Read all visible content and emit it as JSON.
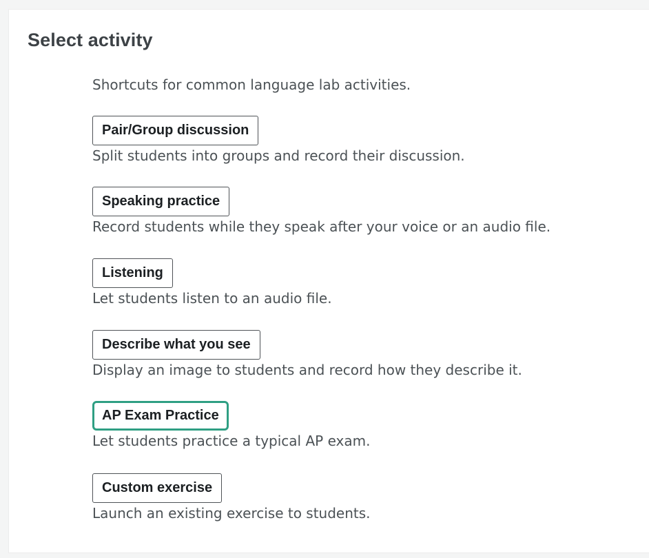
{
  "title": "Select activity",
  "subtitle": "Shortcuts for common language lab activities.",
  "activities": [
    {
      "label": "Pair/Group discussion",
      "description": "Split students into groups and record their discussion."
    },
    {
      "label": "Speaking practice",
      "description": "Record students while they speak after your voice or an audio file."
    },
    {
      "label": "Listening",
      "description": "Let students listen to an audio file."
    },
    {
      "label": "Describe what you see",
      "description": "Display an image to students and record how they describe it."
    },
    {
      "label": "AP Exam Practice",
      "description": "Let students practice a typical AP exam.",
      "focused": true
    },
    {
      "label": "Custom exercise",
      "description": "Launch an existing exercise to students."
    }
  ],
  "colors": {
    "focus_ring": "#2f9f83",
    "text": "#4b5155",
    "title": "#3d4246"
  }
}
